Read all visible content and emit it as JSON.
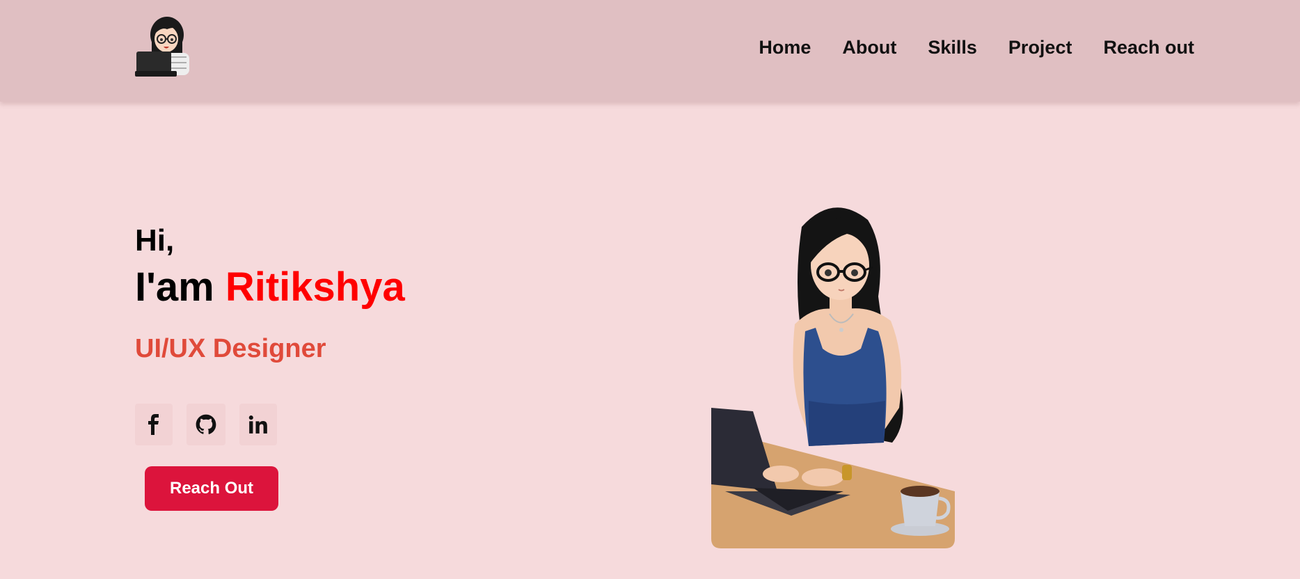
{
  "nav": {
    "logo_alt": "avatar logo",
    "links": [
      "Home",
      "About",
      "Skills",
      "Project",
      "Reach out"
    ]
  },
  "hero": {
    "greeting": "Hi,",
    "intro_prefix": "I'am ",
    "name": "Ritikshya",
    "role": "UI/UX Designer",
    "cta_label": "Reach Out"
  },
  "socials": [
    {
      "icon": "facebook-icon"
    },
    {
      "icon": "github-icon"
    },
    {
      "icon": "linkedin-icon"
    }
  ],
  "colors": {
    "background": "#f6dadc",
    "navbar": "#e0bfc2",
    "name_accent": "#ff0000",
    "role_accent": "#e04a3a",
    "cta": "#dc143c"
  }
}
